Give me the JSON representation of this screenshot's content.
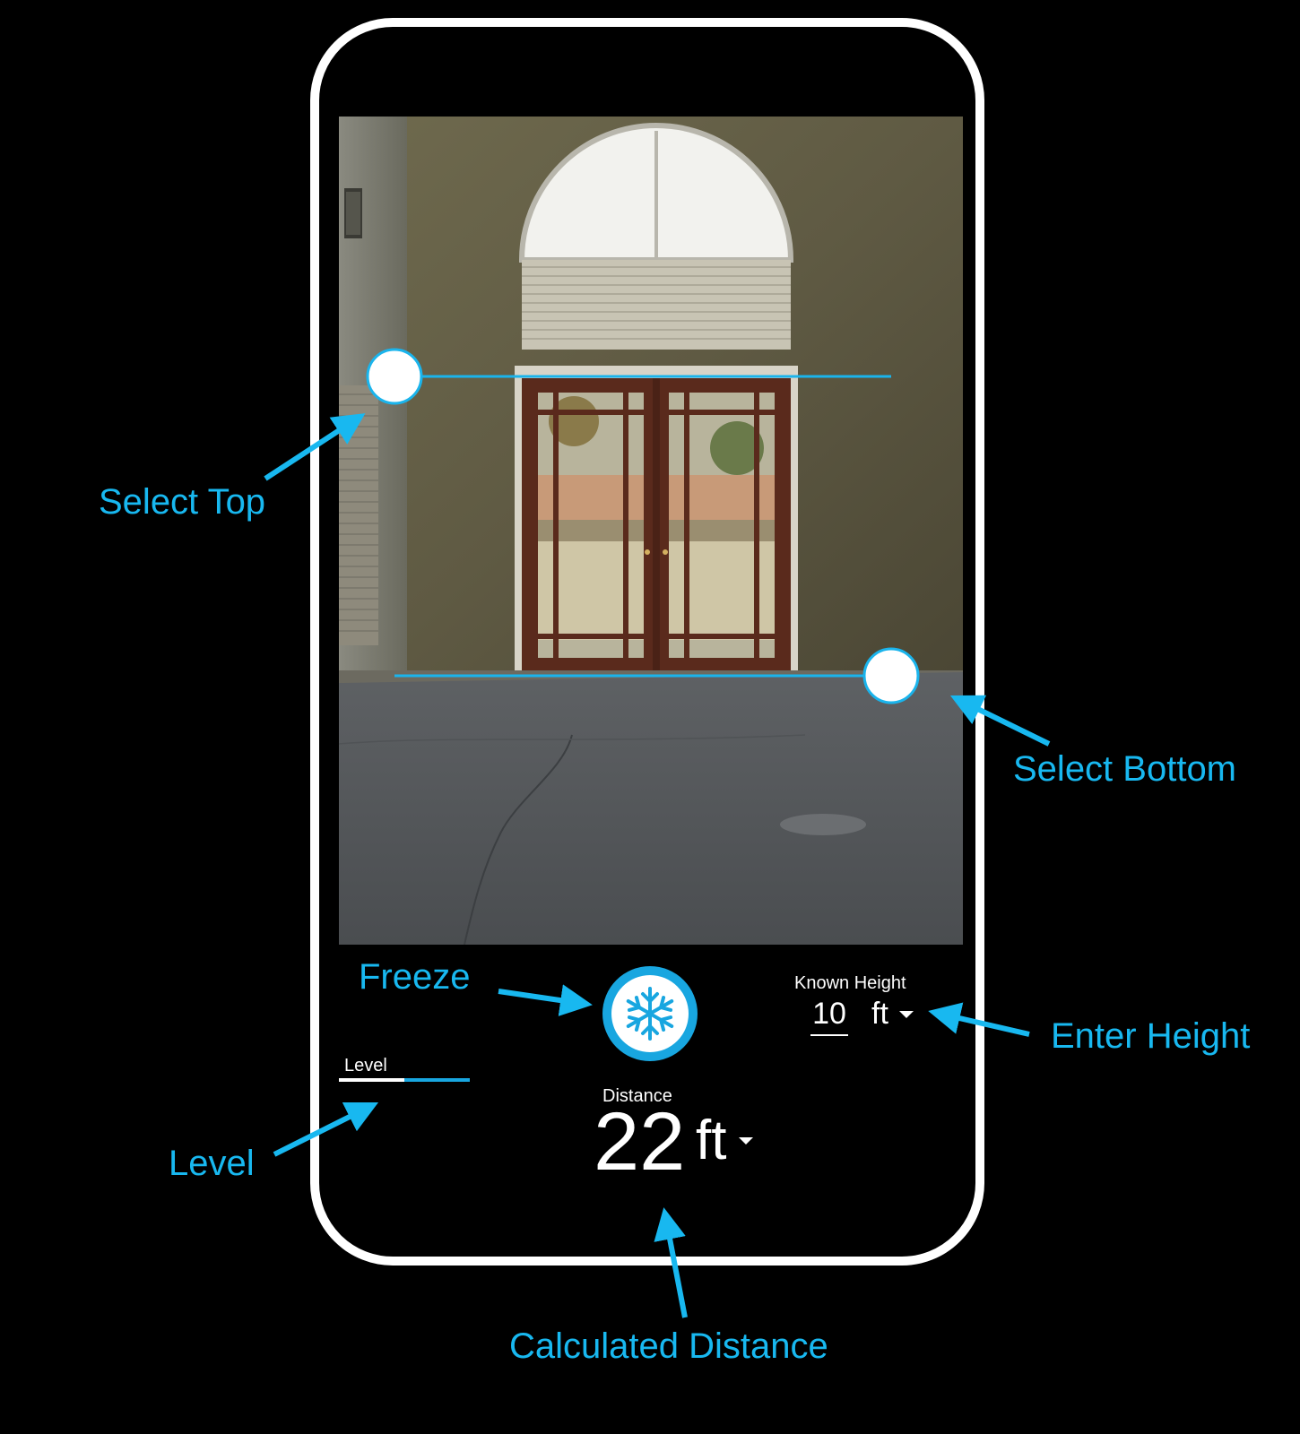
{
  "app": {
    "known_height": {
      "label": "Known Height",
      "value": "10",
      "unit": "ft"
    },
    "level": {
      "label": "Level",
      "value_fraction": 0.5
    },
    "distance": {
      "label": "Distance",
      "value": "22",
      "unit": "ft"
    },
    "freeze_icon": "snowflake-icon"
  },
  "callouts": {
    "select_top": "Select Top",
    "select_bottom": "Select Bottom",
    "freeze": "Freeze",
    "enter_height": "Enter Height",
    "level": "Level",
    "calculated_distance": "Calculated Distance"
  },
  "colors": {
    "accent": "#18a6e0",
    "callout": "#18b8f0",
    "frame": "#ffffff",
    "background": "#000000"
  }
}
